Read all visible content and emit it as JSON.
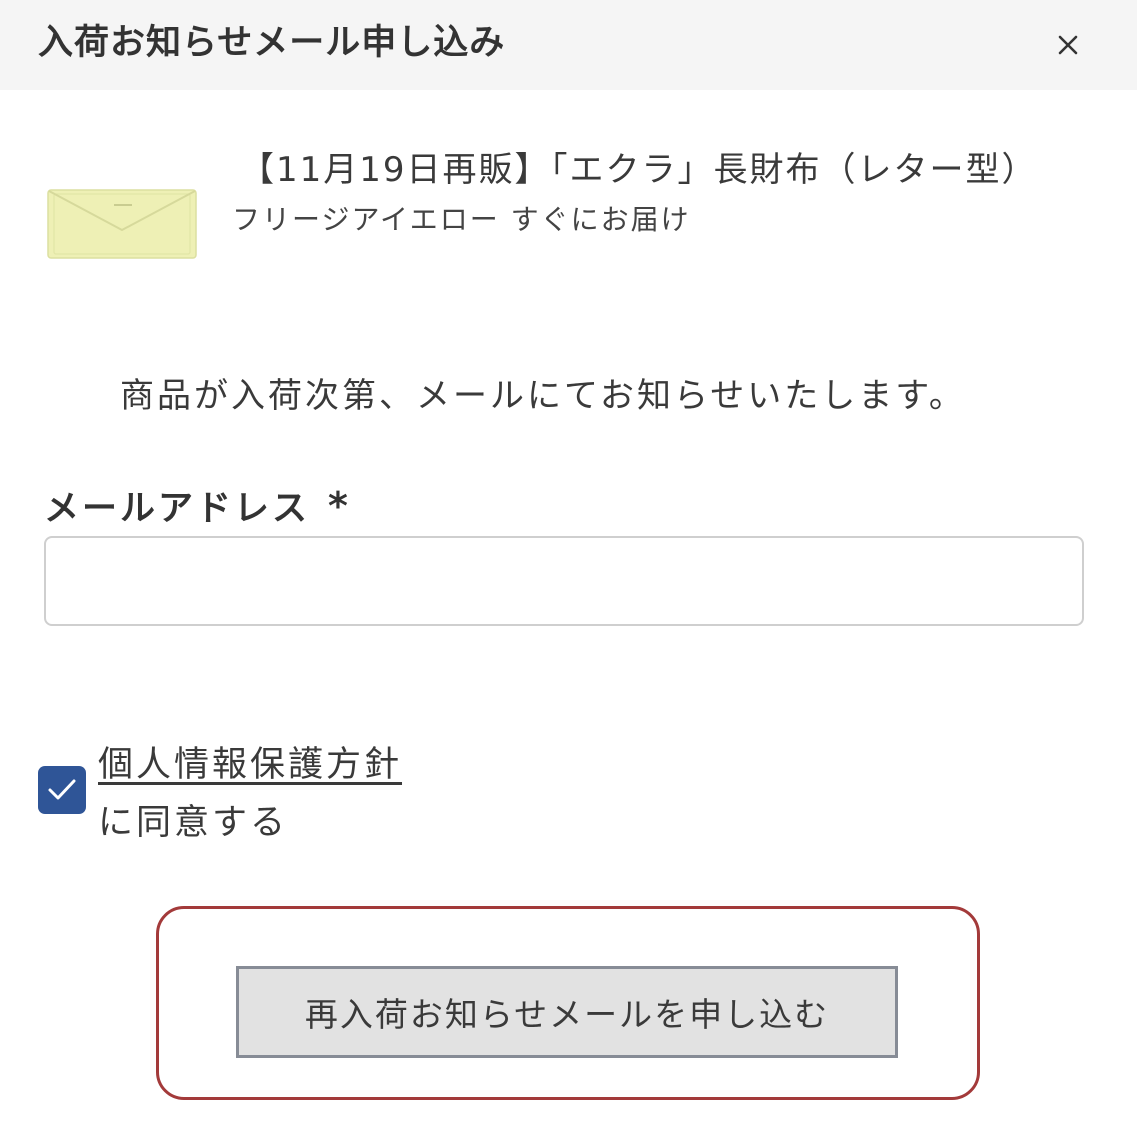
{
  "header": {
    "title": "入荷お知らせメール申し込み",
    "close_icon": "close-icon"
  },
  "product": {
    "name": "【11月19日再販】「エクラ」長財布（レター型）",
    "variant": "フリージアイエロー すぐにお届け",
    "thumbnail_color": "#eef0b5"
  },
  "notice": "商品が入荷次第、メールにてお知らせいたします。",
  "form": {
    "email_label": "メールアドレス",
    "required_mark": "*",
    "email_value": "",
    "email_placeholder": ""
  },
  "consent": {
    "checked": true,
    "link_text": "個人情報保護方針",
    "suffix_text": "に同意する",
    "checkbox_color": "#2f5597"
  },
  "submit": {
    "label": "再入荷お知らせメールを申し込む"
  },
  "colors": {
    "header_bg": "#f5f5f5",
    "highlight_border": "#a33a3a",
    "button_bg": "#e2e2e2"
  }
}
